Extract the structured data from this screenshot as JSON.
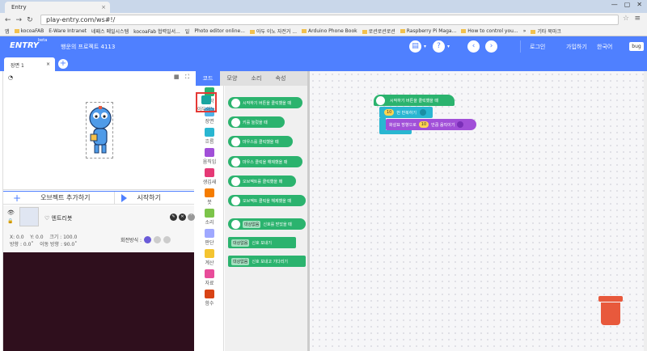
{
  "browser": {
    "tab_title": "Entry",
    "tab_close": "×",
    "window_buttons": [
      "—",
      "▢",
      "✕"
    ],
    "url": "play-entry.com/ws#!/",
    "bookmarks": [
      "앱",
      "kocoaFAB",
      "E-Ware Intranet",
      "네패스 메일시스템",
      "kocoaFab 협력일서...",
      "일",
      "Photo editor online...",
      "아두 이노 자전거 ...",
      "Arduino Phone Book",
      "로션로션로션",
      "Raspberry Pi Maga...",
      "How to control you...",
      "»",
      "기타 북마크"
    ]
  },
  "header": {
    "logo": "ENTRY",
    "beta": "beta",
    "project_title": "행운의 프로젝트 4113",
    "login": "로그인",
    "signup": "가입하기",
    "language": "한국어",
    "bug": "bug"
  },
  "scene": {
    "tab_label": "장면 1",
    "close": "×",
    "add": "+"
  },
  "stage": {
    "add_object": "오브젝트 추가하기",
    "start": "시작하기"
  },
  "object": {
    "name": "엔트리봇",
    "x": "X: 0.0",
    "y": "Y: 0.0",
    "size": "크기 : 100.0",
    "direction": "방향 : 0.0˚",
    "move_direction": "이동 방향 : 90.0˚",
    "rotation_label": "회전방식 :"
  },
  "code_tabs": [
    "코드",
    "모양",
    "소리",
    "속성"
  ],
  "categories": [
    {
      "label": "시작",
      "color": "#2bb36e"
    },
    {
      "label": "장면",
      "color": "#4fb3e8"
    },
    {
      "label": "흐름",
      "color": "#29b6d1"
    },
    {
      "label": "움직임",
      "color": "#a14fd8"
    },
    {
      "label": "생김새",
      "color": "#e53975"
    },
    {
      "label": "붓",
      "color": "#f57c00"
    },
    {
      "label": "소리",
      "color": "#7cc44a"
    },
    {
      "label": "판단",
      "color": "#9fa8ff"
    },
    {
      "label": "계산",
      "color": "#f4c430"
    },
    {
      "label": "자료",
      "color": "#e84c9a"
    },
    {
      "label": "함수",
      "color": "#d84315"
    },
    {
      "label": "아두이노",
      "color": "#19a5a0"
    }
  ],
  "palette_blocks": [
    "시작하기 버튼을 클릭했을 때",
    "키를 눌렀을 때",
    "마우스를 클릭했을 때",
    "마우스 클릭을 해제했을 때",
    "오브젝트를 클릭했을 때",
    "오브젝트 클릭을 해제했을 때",
    "신호를 받았을 때",
    "신호 보내기",
    "신호 보내고 기다리기"
  ],
  "palette_tag": "대상없음",
  "script": {
    "start_block": "시작하기 버튼을 클릭했을 때",
    "repeat_count": "10",
    "repeat_label": "번 반복하기",
    "move_prefix": "화살표 방향으로",
    "move_count": "10",
    "move_suffix": "만큼 움직이기"
  },
  "colors": {
    "accent": "#4f80ff",
    "start": "#2bb36e",
    "flow": "#29b6d1",
    "move": "#a14fd8"
  }
}
